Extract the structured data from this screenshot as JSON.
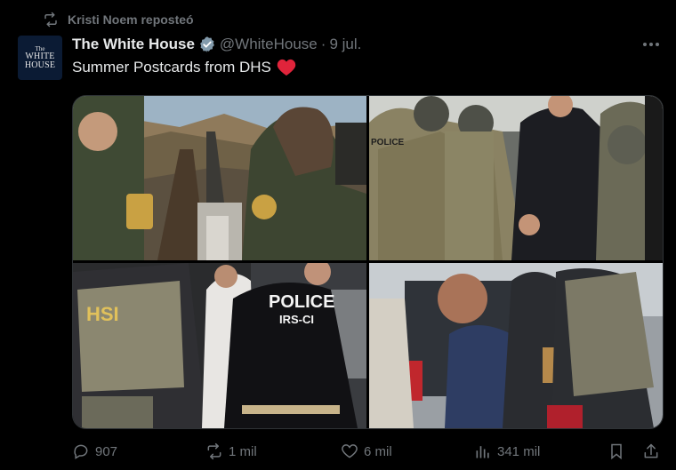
{
  "repost": {
    "label": "Kristi Noem reposteó",
    "icon": "repost-icon"
  },
  "author": {
    "avatar_line1": "The",
    "avatar_line2": "WHITE",
    "avatar_line3": "HOUSE",
    "name": "The White House",
    "handle": "@WhiteHouse",
    "separator": "·",
    "time": "9 jul."
  },
  "tweet": {
    "text": "Summer Postcards from DHS"
  },
  "media": {
    "photos": [
      {
        "badge": ""
      },
      {
        "badge": "POLICE"
      },
      {
        "vest": "HSI",
        "back_line1": "POLICE",
        "back_line2": "IRS-CI"
      },
      {
        "badge": ""
      }
    ]
  },
  "actions": {
    "replies": "907",
    "reposts": "1 mil",
    "likes": "6 mil",
    "views": "341 mil"
  },
  "colors": {
    "background": "#000000",
    "secondary_text": "#71767b",
    "verified": "#829aab",
    "heart": "#e0243b"
  }
}
